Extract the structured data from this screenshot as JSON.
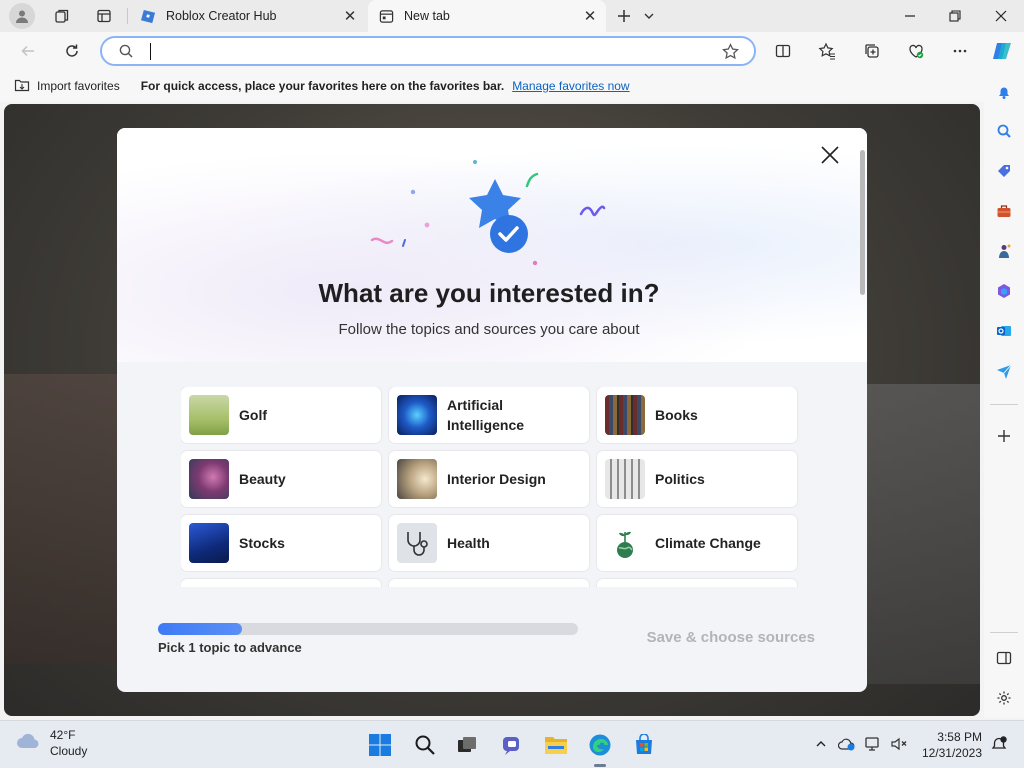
{
  "browser": {
    "tabs": [
      {
        "title": "Roblox Creator Hub",
        "active": false
      },
      {
        "title": "New tab",
        "active": true
      }
    ],
    "address": {
      "value": "",
      "placeholder": ""
    }
  },
  "favorites_bar": {
    "import_label": "Import favorites",
    "quick_access_text": "For quick access, place your favorites here on the favorites bar.",
    "manage_link": "Manage favorites now"
  },
  "modal": {
    "title": "What are you interested in?",
    "subtitle": "Follow the topics and sources you care about",
    "topics": [
      {
        "label": "Golf",
        "thumb_color": "#9fbf6a"
      },
      {
        "label": "Artificial Intelligence",
        "thumb_color": "#1e3a8a"
      },
      {
        "label": "Books",
        "thumb_color": "#7a4a33"
      },
      {
        "label": "Beauty",
        "thumb_color": "#8a4c7a"
      },
      {
        "label": "Interior Design",
        "thumb_color": "#c9b79b"
      },
      {
        "label": "Politics",
        "thumb_color": "#9a9a9a"
      },
      {
        "label": "Stocks",
        "thumb_color": "#1d3fa8"
      },
      {
        "label": "Health",
        "thumb_color": "#d6dadf"
      },
      {
        "label": "Climate Change",
        "thumb_color": "#ffffff"
      }
    ],
    "progress_percent": 20,
    "progress_hint": "Pick 1 topic to advance",
    "save_button": "Save & choose sources"
  },
  "taskbar": {
    "weather_temp": "42°F",
    "weather_desc": "Cloudy",
    "time": "3:58 PM",
    "date": "12/31/2023"
  },
  "colors": {
    "accent": "#3d7bf5",
    "link": "#0b63c4",
    "address_border": "#8ab4f8"
  }
}
